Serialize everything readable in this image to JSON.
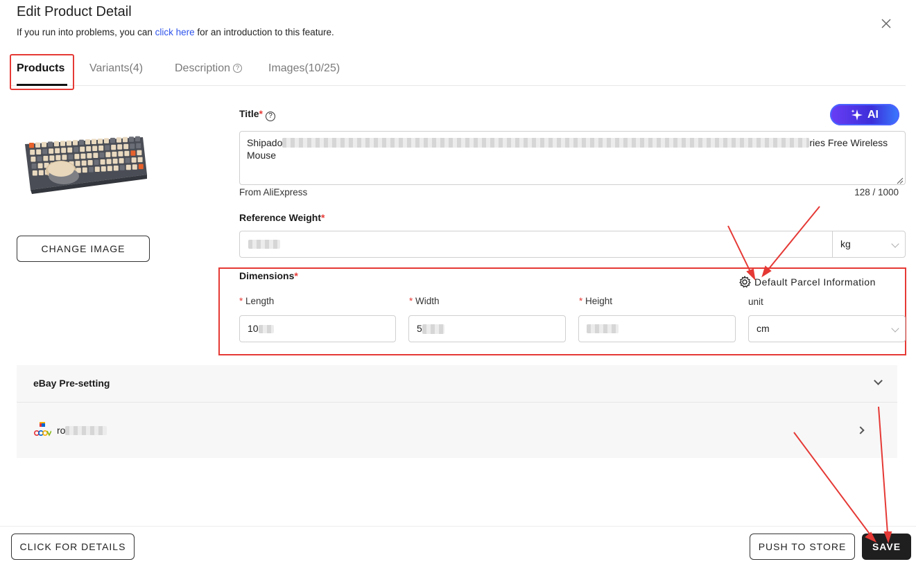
{
  "dialog": {
    "title": "Edit Product Detail",
    "subtitle_prefix": "If you run into problems, you can ",
    "subtitle_link": "click here",
    "subtitle_suffix": " for an introduction to this feature."
  },
  "tabs": [
    {
      "label": "Products",
      "active": true
    },
    {
      "label": "Variants(4)",
      "active": false
    },
    {
      "label": "Description",
      "active": false
    },
    {
      "label": "Images(10/25)",
      "active": false
    }
  ],
  "image_panel": {
    "change_image_label": "CHANGE IMAGE"
  },
  "title_field": {
    "label": "Title",
    "ai_label": "AI",
    "value_start": "Shipado",
    "value_end": "ries Free Wireless Mouse",
    "source": "From AliExpress",
    "char_count": "128 / 1000"
  },
  "weight_field": {
    "label": "Reference Weight",
    "unit": "kg"
  },
  "dimensions": {
    "label": "Dimensions",
    "parcel_link": "Default Parcel Information",
    "length_label": "Length",
    "length_value": "10",
    "width_label": "Width",
    "width_value": "5",
    "height_label": "Height",
    "unit_label": "unit",
    "unit_value": "cm"
  },
  "ebay": {
    "section_title": "eBay Pre-setting",
    "store_prefix": "ro"
  },
  "footer": {
    "details_label": "CLICK FOR DETAILS",
    "push_label": "PUSH TO STORE",
    "save_label": "SAVE"
  },
  "colors": {
    "annotation_red": "#e53935",
    "link_blue": "#2f54eb",
    "save_bg": "#1f1f1f",
    "ai_gradient_start": "#6a3df5",
    "ai_gradient_end": "#3a7bff"
  }
}
